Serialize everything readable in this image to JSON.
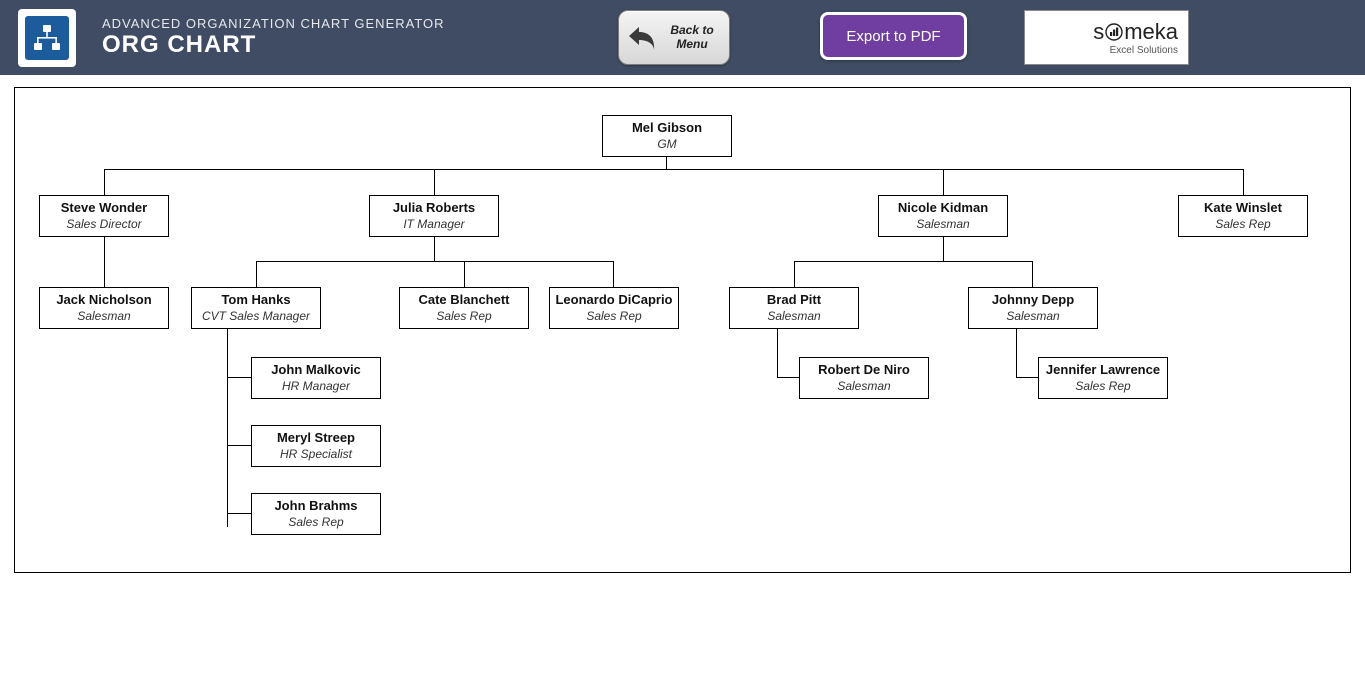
{
  "header": {
    "subtitle": "ADVANCED ORGANIZATION CHART GENERATOR",
    "title": "ORG CHART",
    "back_label": "Back to Menu",
    "export_label": "Export to PDF",
    "brand_name": "someka",
    "brand_tag": "Excel Solutions"
  },
  "chart_data": {
    "type": "org-chart",
    "root": {
      "name": "Mel Gibson",
      "role": "GM",
      "children": [
        {
          "name": "Steve Wonder",
          "role": "Sales Director",
          "children": [
            {
              "name": "Jack Nicholson",
              "role": "Salesman"
            }
          ]
        },
        {
          "name": "Julia Roberts",
          "role": "IT Manager",
          "children": [
            {
              "name": "Tom Hanks",
              "role": "CVT Sales Manager",
              "children": [
                {
                  "name": "John Malkovic",
                  "role": "HR Manager"
                },
                {
                  "name": "Meryl Streep",
                  "role": "HR Specialist"
                },
                {
                  "name": "John Brahms",
                  "role": "Sales Rep"
                }
              ]
            },
            {
              "name": "Cate Blanchett",
              "role": "Sales Rep"
            },
            {
              "name": "Leonardo DiCaprio",
              "role": "Sales Rep"
            }
          ]
        },
        {
          "name": "Nicole Kidman",
          "role": "Salesman",
          "children": [
            {
              "name": "Brad Pitt",
              "role": "Salesman",
              "children": [
                {
                  "name": "Robert De Niro",
                  "role": "Salesman"
                }
              ]
            },
            {
              "name": "Johnny Depp",
              "role": "Salesman",
              "children": [
                {
                  "name": "Jennifer Lawrence",
                  "role": "Sales Rep"
                }
              ]
            }
          ]
        },
        {
          "name": "Kate Winslet",
          "role": "Sales Rep"
        }
      ]
    }
  },
  "nodes": {
    "mel": {
      "name": "Mel Gibson",
      "role": "GM"
    },
    "steve": {
      "name": "Steve Wonder",
      "role": "Sales Director"
    },
    "julia": {
      "name": "Julia Roberts",
      "role": "IT Manager"
    },
    "nicole": {
      "name": "Nicole Kidman",
      "role": "Salesman"
    },
    "kate": {
      "name": "Kate Winslet",
      "role": "Sales Rep"
    },
    "jack": {
      "name": "Jack Nicholson",
      "role": "Salesman"
    },
    "tom": {
      "name": "Tom Hanks",
      "role": "CVT Sales Manager"
    },
    "cate": {
      "name": "Cate Blanchett",
      "role": "Sales Rep"
    },
    "leo": {
      "name": "Leonardo DiCaprio",
      "role": "Sales Rep"
    },
    "brad": {
      "name": "Brad Pitt",
      "role": "Salesman"
    },
    "johnny": {
      "name": "Johnny Depp",
      "role": "Salesman"
    },
    "john_m": {
      "name": "John Malkovic",
      "role": "HR Manager"
    },
    "meryl": {
      "name": "Meryl Streep",
      "role": "HR Specialist"
    },
    "john_b": {
      "name": "John Brahms",
      "role": "Sales Rep"
    },
    "robert": {
      "name": "Robert De Niro",
      "role": "Salesman"
    },
    "jennifer": {
      "name": "Jennifer Lawrence",
      "role": "Sales Rep"
    }
  }
}
